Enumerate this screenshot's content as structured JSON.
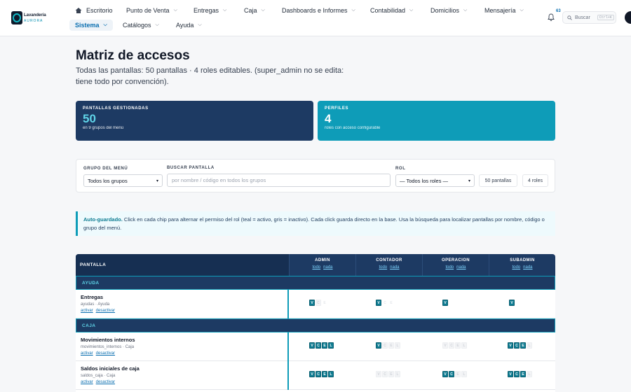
{
  "brand": {
    "name": "Lavandería",
    "sub": "AURORA"
  },
  "nav": {
    "row1": [
      {
        "label": "Escritorio",
        "chev": false
      },
      {
        "label": "Punto de Venta",
        "chev": true
      },
      {
        "label": "Entregas",
        "chev": true
      },
      {
        "label": "Caja",
        "chev": true
      },
      {
        "label": "Dashboards e Informes",
        "chev": true
      },
      {
        "label": "Contabilidad",
        "chev": true
      },
      {
        "label": "Domicilios",
        "chev": true
      },
      {
        "label": "Mensajería",
        "chev": true
      }
    ],
    "row2": [
      {
        "label": "Sistema",
        "active": true
      },
      {
        "label": "Catálogos",
        "active": false
      },
      {
        "label": "Ayuda",
        "active": false
      }
    ],
    "notifications": "63",
    "search_label": "Buscar",
    "search_kbd": "Ctrl+K"
  },
  "page": {
    "title": "Matriz de accesos",
    "subtitle": "Todas las pantallas: 50 pantallas · 4 roles editables. (super_admin no se edita: tiene todo por convención)."
  },
  "stats": [
    {
      "label": "PANTALLAS GESTIONADAS",
      "value": "50",
      "desc": "en 9 grupos del menú"
    },
    {
      "label": "PERFILES",
      "value": "4",
      "desc": "roles con acceso configurable"
    }
  ],
  "filters": {
    "group_label": "GRUPO DEL MENÚ",
    "group_value": "Todos los grupos",
    "search_label": "BUSCAR PANTALLA",
    "search_placeholder": "por nombre / código en todos los grupos",
    "role_label": "ROL",
    "role_value": "— Todos los roles —",
    "count_screens": "50 pantallas",
    "count_roles": "4 roles"
  },
  "info": {
    "strong": "Auto-guardado.",
    "text": " Click en cada chip para alternar el permiso del rol (teal = activo, gris = inactivo). Cada click guarda directo en la base. Usa la búsqueda para localizar pantallas por nombre, código o grupo del menú."
  },
  "matrix": {
    "screen_header": "PANTALLA",
    "all_label": "todo",
    "none_label": "nada",
    "activate_label": "activar",
    "deactivate_label": "desactivar",
    "roles": [
      "ADMIN",
      "CONTADOR",
      "OPERACION",
      "SUBADMIN"
    ],
    "groups": [
      {
        "name": "AYUDA",
        "screens": [
          {
            "name": "Entregas",
            "code": "ayudas · Ayuda",
            "perms": [
              [
                "V",
                "C",
                "E"
              ],
              [
                "V",
                "C",
                "E"
              ],
              [
                "V"
              ],
              [
                "V"
              ]
            ],
            "states": [
              [
                1,
                0,
                2
              ],
              [
                1,
                2,
                2
              ],
              [
                1
              ],
              [
                1
              ]
            ]
          }
        ]
      },
      {
        "name": "CAJA",
        "screens": [
          {
            "name": "Movimientos internos",
            "code": "movimientos_internos · Caja",
            "perms": [
              [
                "V",
                "C",
                "E",
                "L"
              ],
              [
                "V",
                "C",
                "E",
                "L"
              ],
              [
                "V",
                "C",
                "E",
                "L"
              ],
              [
                "V",
                "C",
                "E",
                "L"
              ]
            ],
            "states": [
              [
                1,
                1,
                1,
                1
              ],
              [
                1,
                0,
                0,
                0
              ],
              [
                0,
                0,
                0,
                0
              ],
              [
                1,
                1,
                1,
                0
              ]
            ]
          },
          {
            "name": "Saldos iniciales de caja",
            "code": "saldos_caja · Caja",
            "perms": [
              [
                "V",
                "C",
                "E",
                "L"
              ],
              [
                "V",
                "C",
                "E",
                "L"
              ],
              [
                "V",
                "C",
                "E",
                "L"
              ],
              [
                "V",
                "C",
                "E",
                "L"
              ]
            ],
            "states": [
              [
                1,
                1,
                1,
                1
              ],
              [
                0,
                0,
                0,
                0
              ],
              [
                1,
                1,
                0,
                0
              ],
              [
                1,
                1,
                1,
                0
              ]
            ]
          }
        ]
      }
    ]
  }
}
